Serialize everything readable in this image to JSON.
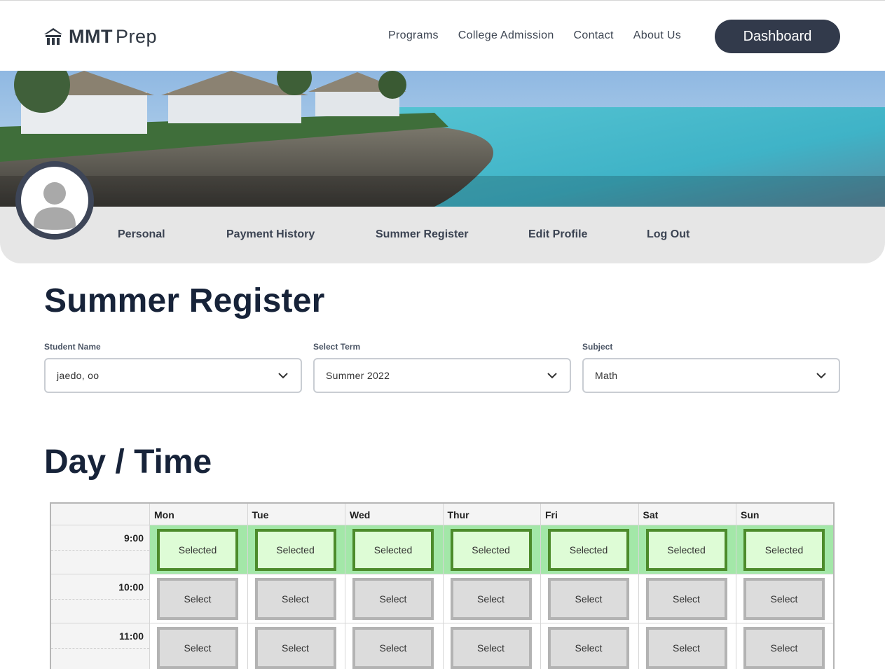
{
  "brand": {
    "bold": "MMT",
    "light": "Prep",
    "icon": "house-columns-icon"
  },
  "nav": {
    "items": [
      "Programs",
      "College Admission",
      "Contact",
      "About Us"
    ],
    "dashboard_label": "Dashboard"
  },
  "profile": {
    "avatar_icon": "user-silhouette-icon",
    "tabs": [
      "Personal",
      "Payment History",
      "Summer Register",
      "Edit Profile",
      "Log Out"
    ]
  },
  "page_title": "Summer Register",
  "fields": {
    "student": {
      "label": "Student Name",
      "value": "jaedo, oo"
    },
    "term": {
      "label": "Select Term",
      "value": "Summer 2022"
    },
    "subject": {
      "label": "Subject",
      "value": "Math"
    }
  },
  "schedule": {
    "title": "Day / Time",
    "days": [
      "Mon",
      "Tue",
      "Wed",
      "Thur",
      "Fri",
      "Sat",
      "Sun"
    ],
    "selected_label": "Selected",
    "select_label": "Select",
    "rows": [
      {
        "time": "9:00",
        "selected": [
          true,
          true,
          true,
          true,
          true,
          true,
          true
        ]
      },
      {
        "time": "10:00",
        "selected": [
          false,
          false,
          false,
          false,
          false,
          false,
          false
        ]
      },
      {
        "time": "11:00",
        "selected": [
          false,
          false,
          false,
          false,
          false,
          false,
          false
        ]
      }
    ]
  },
  "colors": {
    "primary_dark": "#323a4b",
    "heading": "#172339",
    "selected_fill": "#defcd6",
    "selected_border": "#4c8b2b",
    "selected_row": "#a3e7a8",
    "unselected_fill": "#dcdcdc"
  }
}
